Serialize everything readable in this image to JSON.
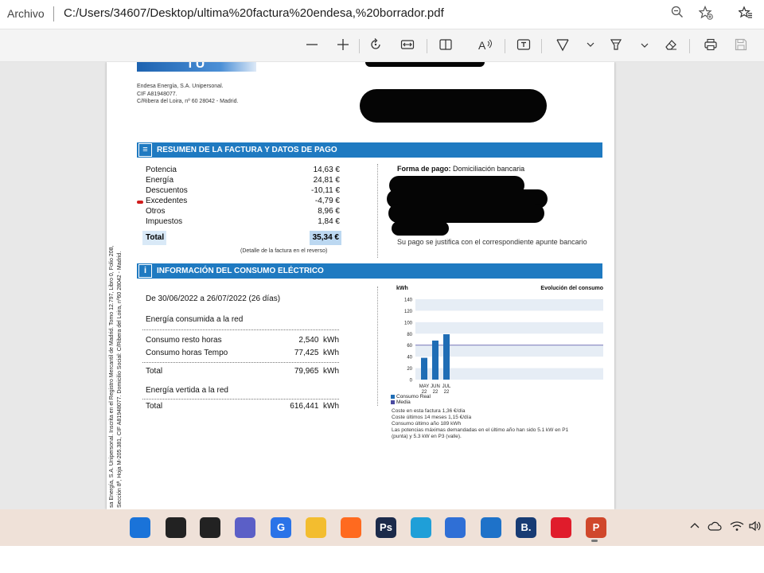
{
  "address_bar": {
    "scheme_label": "Archivo",
    "url": "C:/Users/34607/Desktop/ultima%20factura%20endesa,%20borrador.pdf",
    "icons": [
      "zoom-out-icon",
      "add-favorite-icon",
      "favorites-icon"
    ]
  },
  "pdf_toolbar": {
    "tools": [
      "zoom-out",
      "zoom-in",
      "rotate",
      "fit-page",
      "page-view",
      "read-aloud",
      "add-text",
      "draw",
      "highlight",
      "erase",
      "print",
      "save"
    ]
  },
  "document": {
    "issuer": {
      "line1": "Endesa Energía, S.A. Unipersonal.",
      "line2": "CIF A81948077.",
      "line3": "C/Ribera del Loira, nº 60 28042 - Madrid."
    },
    "side_legal": {
      "line1": "sa Energía, S.A. Unipersonal. Inscrita en el Registro Mercantil de Madrid. Tomo 12.797, Libro 0, Folio 208,",
      "line2": "Sección 8ª, Hoja M-205.381, CIF A81948077. Domicilio Social: C/Ribera del Loira, nº60 28042 - Madrid."
    },
    "summary": {
      "title": "RESUMEN DE LA FACTURA Y DATOS DE PAGO",
      "rows": [
        {
          "label": "Potencia",
          "value": "14,63 €"
        },
        {
          "label": "Energía",
          "value": "24,81 €"
        },
        {
          "label": "Descuentos",
          "value": "-10,11 €"
        },
        {
          "label": "Excedentes",
          "value": "-4,79 €"
        },
        {
          "label": "Otros",
          "value": "8,96 €"
        },
        {
          "label": "Impuestos",
          "value": "1,84 €"
        }
      ],
      "total_label": "Total",
      "total_value": "35,34 €",
      "detail_note": "(Detalle de la factura en el reverso)",
      "payment_label": "Forma de pago:",
      "payment_value": "Domiciliación bancaria",
      "payment_note": "Su pago se justifica con el correspondiente apunte bancario"
    },
    "consumption": {
      "title": "INFORMACIÓN DEL CONSUMO ELÉCTRICO",
      "period": "De 30/06/2022 a 26/07/2022 (26 días)",
      "consumed_heading": "Energía consumida a la red",
      "rows": [
        {
          "label": "Consumo resto horas",
          "value": "2,540",
          "unit": "kWh"
        },
        {
          "label": "Consumo horas Tempo",
          "value": "77,425",
          "unit": "kWh"
        }
      ],
      "total_label": "Total",
      "total_value": "79,965",
      "total_unit": "kWh",
      "exported_heading": "Energía vertida a la red",
      "exported_total_label": "Total",
      "exported_total_value": "616,441",
      "exported_total_unit": "kWh"
    },
    "notes": {
      "line1": "Coste en esta factura 1,36 €/día",
      "line2": "Coste últimos 14 meses 1,15 €/día",
      "line3": "Consumo último año  189 kWh",
      "line4": "Las potencias máximas demandadas en el último año han sido 5.1 kW en P1",
      "line5": "(punta) y 5.3 kW en P3 (valle)."
    }
  },
  "chart_data": {
    "type": "bar",
    "title": "Evolución del consumo",
    "ylabel": "kWh",
    "categories": [
      "MAY 22",
      "JUN 22",
      "JUL 22"
    ],
    "category_lines": [
      [
        "MAY",
        "22"
      ],
      [
        "JUN",
        "22"
      ],
      [
        "JUL",
        "22"
      ]
    ],
    "series": [
      {
        "name": "Consumo Real",
        "values": [
          38,
          68,
          79
        ],
        "color": "#1f6db5"
      }
    ],
    "average": {
      "name": "Media",
      "value": 60,
      "color": "#4a4aa0"
    },
    "yticks": [
      0,
      20,
      40,
      60,
      80,
      100,
      120,
      140
    ],
    "ylim": [
      0,
      140
    ],
    "grid": "bands",
    "legend": "bottom-left"
  },
  "taskbar": {
    "apps": [
      {
        "name": "start",
        "glyph": "",
        "color": "#1a73d9"
      },
      {
        "name": "search",
        "glyph": "",
        "color": "#222222"
      },
      {
        "name": "task-view",
        "glyph": "",
        "color": "#222222"
      },
      {
        "name": "teams-chat",
        "glyph": "",
        "color": "#5b5fc7"
      },
      {
        "name": "google-chrome",
        "glyph": "G",
        "color": "#2a73e8"
      },
      {
        "name": "file-explorer",
        "glyph": "",
        "color": "#f3bd2f"
      },
      {
        "name": "firefox",
        "glyph": "",
        "color": "#ff6a1f"
      },
      {
        "name": "photoshop",
        "glyph": "Ps",
        "color": "#1b2a4a"
      },
      {
        "name": "edge",
        "glyph": "",
        "color": "#1f9fd8"
      },
      {
        "name": "store",
        "glyph": "",
        "color": "#2f6fd6"
      },
      {
        "name": "mail",
        "glyph": "",
        "color": "#1e72c9"
      },
      {
        "name": "b-app",
        "glyph": "B.",
        "color": "#173b74"
      },
      {
        "name": "opera",
        "glyph": "",
        "color": "#e01c2b"
      },
      {
        "name": "powerpoint",
        "glyph": "P",
        "color": "#d0472b"
      }
    ],
    "tray_icons": [
      "chevron-up-icon",
      "cloud-icon",
      "wifi-icon",
      "volume-icon"
    ]
  }
}
